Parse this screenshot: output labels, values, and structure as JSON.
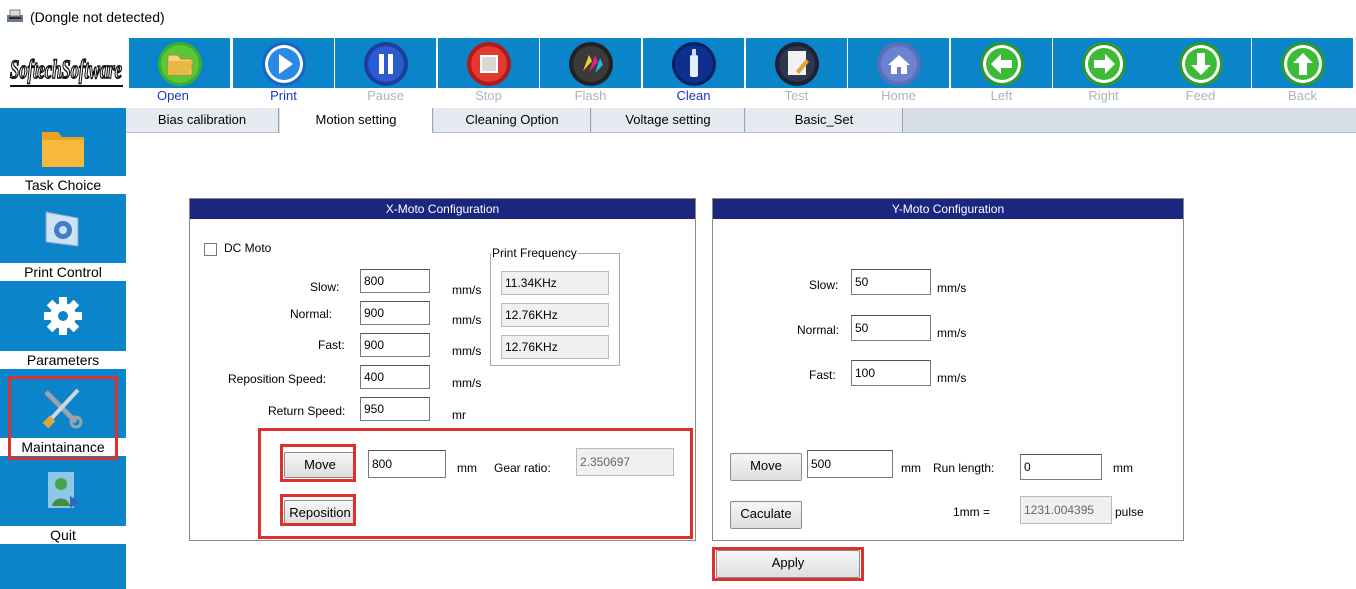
{
  "window": {
    "title": "(Dongle not detected)"
  },
  "logo": {
    "text": "Softech Software"
  },
  "toolbar": {
    "buttons": [
      {
        "label": "Open",
        "icon": "folder-open-icon",
        "enabled": true
      },
      {
        "label": "Print",
        "icon": "play-icon",
        "enabled": true
      },
      {
        "label": "Pause",
        "icon": "pause-icon",
        "enabled": false
      },
      {
        "label": "Stop",
        "icon": "stop-icon",
        "enabled": false
      },
      {
        "label": "Flash",
        "icon": "ink-drop-icon",
        "enabled": false
      },
      {
        "label": "Clean",
        "icon": "bottle-icon",
        "enabled": true
      },
      {
        "label": "Test",
        "icon": "test-page-icon",
        "enabled": false
      },
      {
        "label": "Home",
        "icon": "home-icon",
        "enabled": false
      },
      {
        "label": "Left",
        "icon": "arrow-left-icon",
        "enabled": false
      },
      {
        "label": "Right",
        "icon": "arrow-right-icon",
        "enabled": false
      },
      {
        "label": "Feed",
        "icon": "arrow-down-icon",
        "enabled": false
      },
      {
        "label": "Back",
        "icon": "arrow-up-icon",
        "enabled": false
      }
    ]
  },
  "nav": {
    "items": [
      {
        "label": "Task Choice",
        "icon": "folder-icon"
      },
      {
        "label": "Print Control",
        "icon": "print-control-icon"
      },
      {
        "label": "Parameters",
        "icon": "gear-icon"
      },
      {
        "label": "Maintainance",
        "icon": "tools-icon",
        "highlighted": true
      },
      {
        "label": "Quit",
        "icon": "quit-icon"
      }
    ]
  },
  "tabs": [
    {
      "label": "Bias calibration"
    },
    {
      "label": "Motion setting",
      "active": true
    },
    {
      "label": "Cleaning Option"
    },
    {
      "label": "Voltage setting"
    },
    {
      "label": "Basic_Set"
    }
  ],
  "xmoto": {
    "header": "X-Moto Configuration",
    "dc_moto_label": "DC Moto",
    "dc_moto_checked": false,
    "slow_label": "Slow:",
    "slow_value": "800",
    "slow_unit": "mm/s",
    "normal_label": "Normal:",
    "normal_value": "900",
    "normal_unit": "mm/s",
    "fast_label": "Fast:",
    "fast_value": "900",
    "fast_unit": "mm/s",
    "reposition_speed_label": "Reposition Speed:",
    "reposition_speed_value": "400",
    "reposition_speed_unit": "mm/s",
    "return_speed_label": "Return Speed:",
    "return_speed_value": "950",
    "return_speed_unit": "mr",
    "print_frequency": {
      "legend": "Print Frequency",
      "values": [
        "11.34KHz",
        "12.76KHz",
        "12.76KHz"
      ]
    },
    "move_button": "Move",
    "move_value": "800",
    "move_unit": "mm",
    "gear_ratio_label": "Gear ratio:",
    "gear_ratio_value": "2.350697",
    "reposition_button": "Reposition"
  },
  "ymoto": {
    "header": "Y-Moto Configuration",
    "slow_label": "Slow:",
    "slow_value": "50",
    "slow_unit": "mm/s",
    "normal_label": "Normal:",
    "normal_value": "50",
    "normal_unit": "mm/s",
    "fast_label": "Fast:",
    "fast_value": "100",
    "fast_unit": "mm/s",
    "move_button": "Move",
    "move_value": "500",
    "move_unit": "mm",
    "run_length_label": "Run length:",
    "run_length_value": "0",
    "run_length_unit": "mm",
    "calculate_button": "Caculate",
    "mm_label": "1mm =",
    "pulse_value": "1231.004395",
    "pulse_unit": "pulse"
  },
  "apply_button": "Apply",
  "colors": {
    "toolbar_blue": "#0c84c9",
    "header_navy": "#1a2680",
    "highlight_red": "#e0302d",
    "label_blue": "#1b39c4",
    "label_disabled": "#aeb4ba"
  }
}
